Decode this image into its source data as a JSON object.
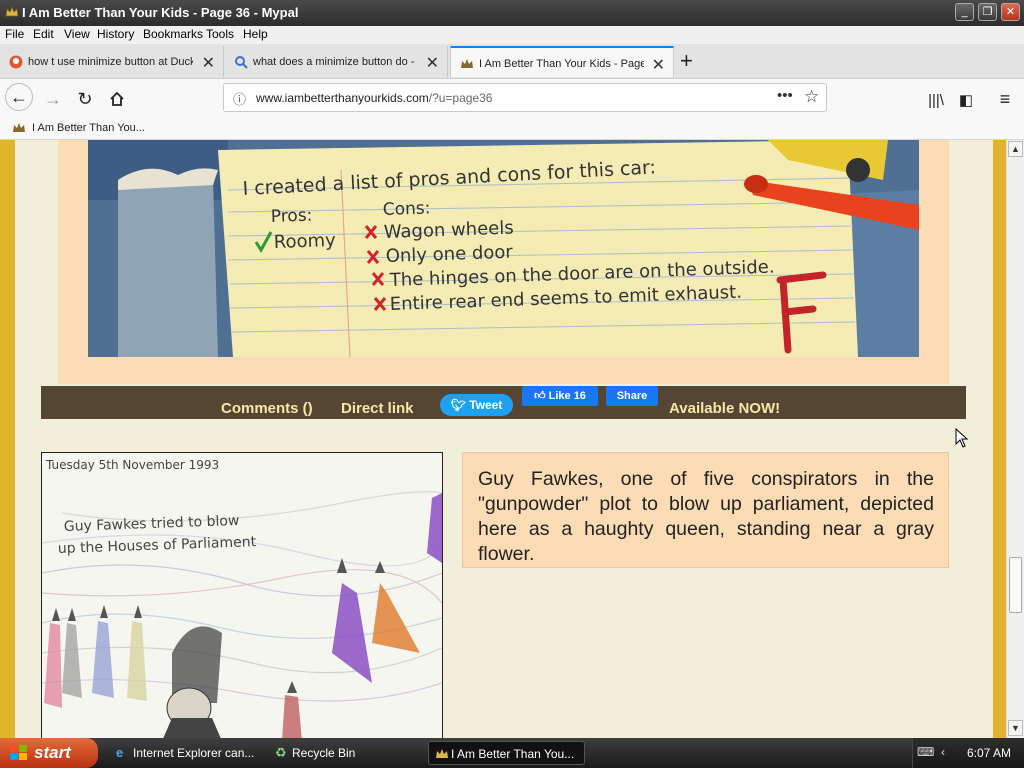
{
  "window": {
    "title": "I Am Better Than Your Kids - Page 36 - Mypal"
  },
  "menubar": [
    "File",
    "Edit",
    "View",
    "History",
    "Bookmarks",
    "Tools",
    "Help"
  ],
  "tabs": [
    {
      "label": "how t use minimize button at Duck",
      "icon": "duckduckgo-icon"
    },
    {
      "label": "what does a minimize button do - ",
      "icon": "search-icon"
    },
    {
      "label": "I Am Better Than Your Kids - Page",
      "icon": "crown-icon",
      "active": true
    }
  ],
  "urlbar": {
    "domain": "www.iambetterthanyourkids.com",
    "path": "/?u=page36"
  },
  "bookmarks": [
    {
      "label": "I Am Better Than You..."
    }
  ],
  "page": {
    "comic": {
      "note_title": "I created a list of pros and cons for this car:",
      "pros_header": "Pros:",
      "cons_header": "Cons:",
      "pros": [
        "Roomy"
      ],
      "cons": [
        "Wagon wheels",
        "Only one door",
        "The hinges on the door are on the outside.",
        "Entire rear end seems to emit exhaust."
      ],
      "grade": "F"
    },
    "comment_bar": {
      "comments": "Comments ()",
      "direct_link": "Direct link",
      "tweet": "Tweet",
      "like": "Like 16",
      "share": "Share",
      "available": "Available NOW!"
    },
    "drawing": {
      "date": "Tuesday  5th    November 1993",
      "line1": "Guy   Fawkes tried to blow",
      "line2": "up the Houses of Parliament"
    },
    "caption": "Guy Fawkes, one of five conspirators in the \"gunpowder\" plot to blow up parliament, depicted here as a haughty queen, standing near a gray flower."
  },
  "taskbar": {
    "start": "start",
    "items": [
      {
        "label": "Internet Explorer can...",
        "icon": "ie-icon"
      },
      {
        "label": "Recycle Bin",
        "icon": "recycle-bin-icon"
      },
      {
        "label": "I Am Better Than You...",
        "icon": "crown-icon",
        "active": true
      }
    ],
    "clock": "6:07 AM"
  },
  "colors": {
    "page_bg": "#f1efd9",
    "stripe": "#e2b42d",
    "comment_bar": "#554533",
    "comment_link": "#f7e7a8",
    "caption_bg": "#fcdcb5",
    "tab_accent": "#0a84ff"
  }
}
